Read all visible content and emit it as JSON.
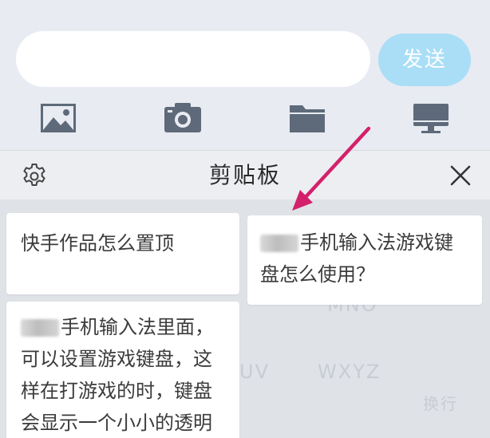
{
  "input_bar": {
    "message_value": "",
    "send_label": "发送",
    "tools": [
      {
        "icon": "image-icon"
      },
      {
        "icon": "camera-icon"
      },
      {
        "icon": "folder-icon"
      },
      {
        "icon": "computer-icon"
      }
    ]
  },
  "clipboard": {
    "title": "剪贴板",
    "settings_icon": "gear-icon",
    "close_icon": "close-icon",
    "items": [
      {
        "text": "快手作品怎么置顶"
      },
      {
        "text_after_blur_line1": "手机输入法游戏键",
        "text_line2": "盘怎么使用？"
      },
      {
        "text_after_blur_line1": "手机输入法里面，",
        "lines": [
          "可以设置游戏键盘，这",
          "样在打游戏的时，键盘",
          "会显示一个小小的透明"
        ]
      }
    ]
  },
  "background_keyboard": {
    "keys": [
      "MNO",
      "UV",
      "WXYZ",
      "换行"
    ]
  },
  "colors": {
    "send_button": "#a9def6",
    "arrow": "#d4206a",
    "panel_bg": "#e8ebf2"
  }
}
